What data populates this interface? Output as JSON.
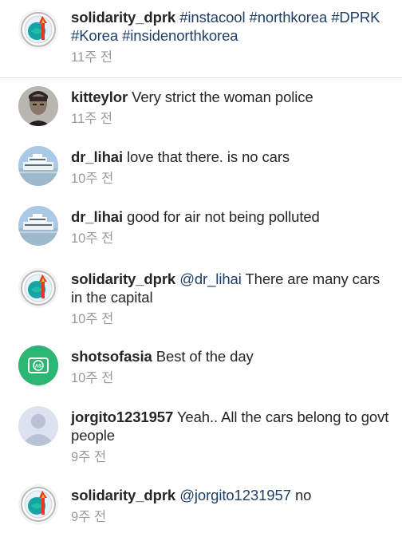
{
  "caption": {
    "username": "solidarity_dprk",
    "hashtags": [
      "#instacool",
      "#northkorea",
      "#DPRK",
      "#Korea",
      "#insidenorthkorea"
    ],
    "time": "11주 전"
  },
  "comments": [
    {
      "username": "kitteylor",
      "mention": "",
      "text": "Very strict the woman  police",
      "time": "11주 전",
      "avatar": "person-photo"
    },
    {
      "username": "dr_lihai",
      "mention": "",
      "text": "love that there. is no cars",
      "time": "10주 전",
      "avatar": "ship-photo"
    },
    {
      "username": "dr_lihai",
      "mention": "",
      "text": "good for air not being polluted",
      "time": "10주 전",
      "avatar": "ship-photo"
    },
    {
      "username": "solidarity_dprk",
      "mention": "@dr_lihai",
      "text": "There are many cars in the capital",
      "time": "10주 전",
      "avatar": "emblem-logo"
    },
    {
      "username": "shotsofasia",
      "mention": "",
      "text": "Best of the day",
      "time": "10주 전",
      "avatar": "as-logo"
    },
    {
      "username": "jorgito1231957",
      "mention": "",
      "text": "Yeah.. All the cars belong to govt people",
      "time": "9주 전",
      "avatar": "default-avatar"
    },
    {
      "username": "solidarity_dprk",
      "mention": "@jorgito1231957",
      "text": "no",
      "time": "9주 전",
      "avatar": "emblem-logo"
    }
  ],
  "colors": {
    "text": "#262626",
    "hashtag": "#1e3f66",
    "timestamp": "#999999",
    "shotsofasia_green": "#2bb673"
  }
}
